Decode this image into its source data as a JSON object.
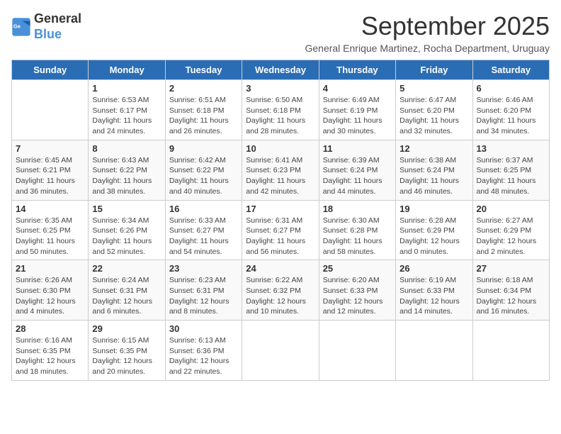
{
  "logo": {
    "line1": "General",
    "line2": "Blue"
  },
  "title": "September 2025",
  "subtitle": "General Enrique Martinez, Rocha Department, Uruguay",
  "days_of_week": [
    "Sunday",
    "Monday",
    "Tuesday",
    "Wednesday",
    "Thursday",
    "Friday",
    "Saturday"
  ],
  "weeks": [
    [
      {
        "day": "",
        "info": ""
      },
      {
        "day": "1",
        "info": "Sunrise: 6:53 AM\nSunset: 6:17 PM\nDaylight: 11 hours\nand 24 minutes."
      },
      {
        "day": "2",
        "info": "Sunrise: 6:51 AM\nSunset: 6:18 PM\nDaylight: 11 hours\nand 26 minutes."
      },
      {
        "day": "3",
        "info": "Sunrise: 6:50 AM\nSunset: 6:18 PM\nDaylight: 11 hours\nand 28 minutes."
      },
      {
        "day": "4",
        "info": "Sunrise: 6:49 AM\nSunset: 6:19 PM\nDaylight: 11 hours\nand 30 minutes."
      },
      {
        "day": "5",
        "info": "Sunrise: 6:47 AM\nSunset: 6:20 PM\nDaylight: 11 hours\nand 32 minutes."
      },
      {
        "day": "6",
        "info": "Sunrise: 6:46 AM\nSunset: 6:20 PM\nDaylight: 11 hours\nand 34 minutes."
      }
    ],
    [
      {
        "day": "7",
        "info": "Sunrise: 6:45 AM\nSunset: 6:21 PM\nDaylight: 11 hours\nand 36 minutes."
      },
      {
        "day": "8",
        "info": "Sunrise: 6:43 AM\nSunset: 6:22 PM\nDaylight: 11 hours\nand 38 minutes."
      },
      {
        "day": "9",
        "info": "Sunrise: 6:42 AM\nSunset: 6:22 PM\nDaylight: 11 hours\nand 40 minutes."
      },
      {
        "day": "10",
        "info": "Sunrise: 6:41 AM\nSunset: 6:23 PM\nDaylight: 11 hours\nand 42 minutes."
      },
      {
        "day": "11",
        "info": "Sunrise: 6:39 AM\nSunset: 6:24 PM\nDaylight: 11 hours\nand 44 minutes."
      },
      {
        "day": "12",
        "info": "Sunrise: 6:38 AM\nSunset: 6:24 PM\nDaylight: 11 hours\nand 46 minutes."
      },
      {
        "day": "13",
        "info": "Sunrise: 6:37 AM\nSunset: 6:25 PM\nDaylight: 11 hours\nand 48 minutes."
      }
    ],
    [
      {
        "day": "14",
        "info": "Sunrise: 6:35 AM\nSunset: 6:25 PM\nDaylight: 11 hours\nand 50 minutes."
      },
      {
        "day": "15",
        "info": "Sunrise: 6:34 AM\nSunset: 6:26 PM\nDaylight: 11 hours\nand 52 minutes."
      },
      {
        "day": "16",
        "info": "Sunrise: 6:33 AM\nSunset: 6:27 PM\nDaylight: 11 hours\nand 54 minutes."
      },
      {
        "day": "17",
        "info": "Sunrise: 6:31 AM\nSunset: 6:27 PM\nDaylight: 11 hours\nand 56 minutes."
      },
      {
        "day": "18",
        "info": "Sunrise: 6:30 AM\nSunset: 6:28 PM\nDaylight: 11 hours\nand 58 minutes."
      },
      {
        "day": "19",
        "info": "Sunrise: 6:28 AM\nSunset: 6:29 PM\nDaylight: 12 hours\nand 0 minutes."
      },
      {
        "day": "20",
        "info": "Sunrise: 6:27 AM\nSunset: 6:29 PM\nDaylight: 12 hours\nand 2 minutes."
      }
    ],
    [
      {
        "day": "21",
        "info": "Sunrise: 6:26 AM\nSunset: 6:30 PM\nDaylight: 12 hours\nand 4 minutes."
      },
      {
        "day": "22",
        "info": "Sunrise: 6:24 AM\nSunset: 6:31 PM\nDaylight: 12 hours\nand 6 minutes."
      },
      {
        "day": "23",
        "info": "Sunrise: 6:23 AM\nSunset: 6:31 PM\nDaylight: 12 hours\nand 8 minutes."
      },
      {
        "day": "24",
        "info": "Sunrise: 6:22 AM\nSunset: 6:32 PM\nDaylight: 12 hours\nand 10 minutes."
      },
      {
        "day": "25",
        "info": "Sunrise: 6:20 AM\nSunset: 6:33 PM\nDaylight: 12 hours\nand 12 minutes."
      },
      {
        "day": "26",
        "info": "Sunrise: 6:19 AM\nSunset: 6:33 PM\nDaylight: 12 hours\nand 14 minutes."
      },
      {
        "day": "27",
        "info": "Sunrise: 6:18 AM\nSunset: 6:34 PM\nDaylight: 12 hours\nand 16 minutes."
      }
    ],
    [
      {
        "day": "28",
        "info": "Sunrise: 6:16 AM\nSunset: 6:35 PM\nDaylight: 12 hours\nand 18 minutes."
      },
      {
        "day": "29",
        "info": "Sunrise: 6:15 AM\nSunset: 6:35 PM\nDaylight: 12 hours\nand 20 minutes."
      },
      {
        "day": "30",
        "info": "Sunrise: 6:13 AM\nSunset: 6:36 PM\nDaylight: 12 hours\nand 22 minutes."
      },
      {
        "day": "",
        "info": ""
      },
      {
        "day": "",
        "info": ""
      },
      {
        "day": "",
        "info": ""
      },
      {
        "day": "",
        "info": ""
      }
    ]
  ]
}
